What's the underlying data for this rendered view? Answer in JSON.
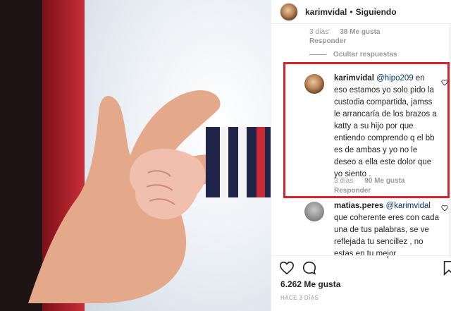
{
  "post": {
    "username": "karimvidal",
    "separator": "•",
    "follow_status": "Siguiendo"
  },
  "prev_comment": {
    "time": "3 días",
    "likes": "38 Me gusta",
    "reply": "Responder",
    "hide_replies": "Ocultar respuestas"
  },
  "comments": [
    {
      "user": "karimvidal",
      "mention": "@hipo209",
      "text": " en eso estamos yo solo pido la custodia compartida, jamss le arrancaría de los brazos a katty a su hijo por que entiendo comprendo q el bb es de ambas y yo no le deseo a ella este dolor que yo siento .",
      "time": "3 días",
      "likes": "90 Me gusta",
      "reply": "Responder"
    },
    {
      "user": "matias.peres",
      "mention": "@karimvidal",
      "text": " que coherente eres con cada una de tus palabras, se ve reflejada tu sencillez , no estas en tu mejor"
    }
  ],
  "footer": {
    "likes": "6.262 Me gusta",
    "posted_ago": "HACE 3 DÍAS"
  },
  "colors": {
    "highlight": "#d9232d",
    "mention": "#003569",
    "meta": "#999999"
  },
  "icons": {
    "like": "heart-outline-icon",
    "comment": "speech-bubble-icon",
    "save": "bookmark-icon",
    "comment_like": "small-heart-icon"
  }
}
